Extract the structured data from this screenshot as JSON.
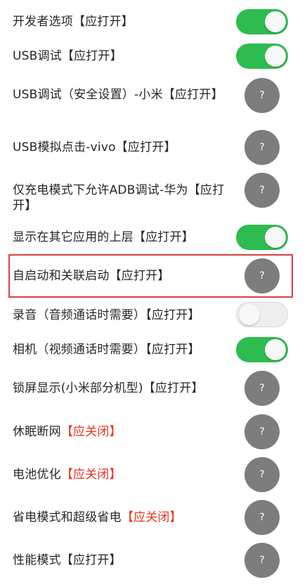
{
  "settings": {
    "items": [
      {
        "label": "开发者选项【应打开】",
        "control": "toggle",
        "state": "on"
      },
      {
        "label": "USB调试【应打开】",
        "control": "toggle",
        "state": "on"
      },
      {
        "label": "USB调试（安全设置）-小米【应打开】",
        "control": "help",
        "help_text": "?"
      },
      {
        "label": "USB模拟点击-vivo【应打开】",
        "control": "help",
        "help_text": "?"
      },
      {
        "label": "仅充电模式下允许ADB调试-华为【应打开】",
        "control": "help",
        "help_text": "?"
      },
      {
        "label": "显示在其它应用的上层【应打开】",
        "control": "toggle",
        "state": "on"
      },
      {
        "label": "自启动和关联启动【应打开】",
        "control": "help",
        "help_text": "?",
        "highlighted": true
      },
      {
        "label": "录音（音频通话时需要）【应打开】",
        "control": "toggle",
        "state": "off"
      },
      {
        "label": "相机（视频通话时需要）【应打开】",
        "control": "toggle",
        "state": "on"
      },
      {
        "label": "锁屏显示(小米部分机型)【应打开】",
        "control": "help",
        "help_text": "?"
      },
      {
        "label_main": "休眠断网",
        "label_warn": "【应关闭】",
        "control": "help",
        "help_text": "?"
      },
      {
        "label_main": "电池优化",
        "label_warn": "【应关闭】",
        "control": "help",
        "help_text": "?"
      },
      {
        "label_main": "省电模式和超级省电",
        "label_warn": "【应关闭】",
        "control": "help",
        "help_text": "?"
      },
      {
        "label": "性能模式【应打开】",
        "control": "help",
        "help_text": "?"
      }
    ]
  },
  "colors": {
    "toggle_on": "#2dbc4f",
    "toggle_off": "#eeeeee",
    "help_button": "#7d7d7d",
    "warning_text": "#e8321e",
    "highlight_border": "#d94040"
  }
}
